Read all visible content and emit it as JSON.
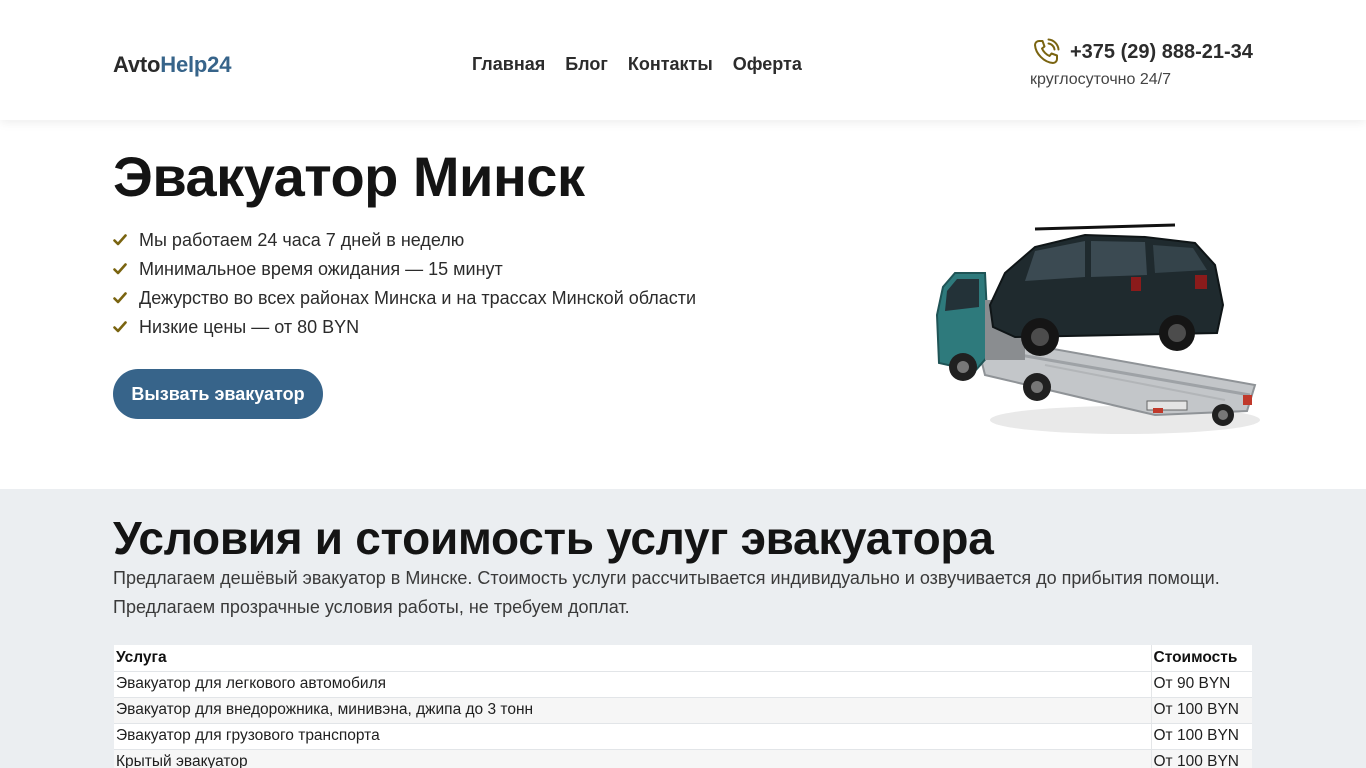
{
  "header": {
    "logo_part1": "Avto",
    "logo_part2": "Help24",
    "nav": [
      "Главная",
      "Блог",
      "Контакты",
      "Оферта"
    ],
    "phone": "+375 (29) 888-21-34",
    "phone_note": "круглосуточно 24/7",
    "phone_icon": "phone-call-icon"
  },
  "hero": {
    "title": "Эвакуатор Минск",
    "features": [
      "Мы работаем 24 часа 7 дней в неделю",
      "Минимальное время ожидания — 15 минут",
      "Дежурство во всех районах Минска и на трассах Минской области",
      "Низкие цены — от 80 BYN"
    ],
    "check_icon": "check-icon",
    "cta_label": "Вызвать эвакуатор",
    "image": "tow-truck-with-suv-image"
  },
  "services": {
    "title": "Условия и стоимость услуг эвакуатора",
    "intro": "Предлагаем дешёвый эвакуатор в Минске. Стоимость услуги рассчитывается индивидуально и озвучивается до прибытия помощи. Предлагаем прозрачные условия работы, не требуем доплат.",
    "table": {
      "headers": [
        "Услуга",
        "Стоимость"
      ],
      "rows": [
        [
          "Эвакуатор для легкового автомобиля",
          "От 90 BYN"
        ],
        [
          "Эвакуатор для внедорожника, минивэна, джипа до 3 тонн",
          "От 100 BYN"
        ],
        [
          "Эвакуатор для грузового транспорта",
          "От 100 BYN"
        ],
        [
          "Крытый эвакуатор",
          "От 100 BYN"
        ]
      ]
    }
  },
  "colors": {
    "brand": "#37648a",
    "check": "#7a6410",
    "section_bg": "#ebeef1"
  }
}
